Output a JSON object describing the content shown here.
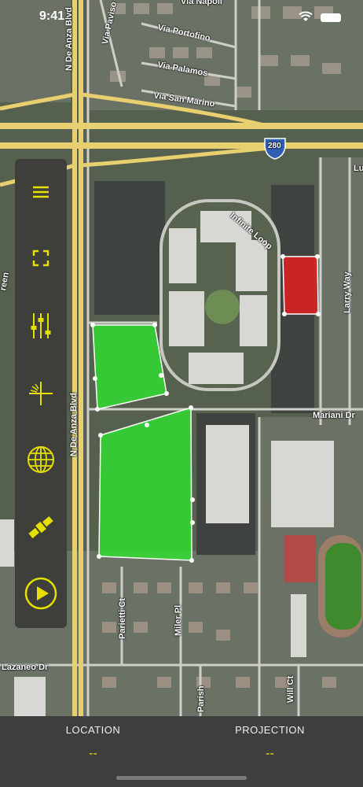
{
  "status_bar": {
    "time": "9:41"
  },
  "map": {
    "streets": {
      "via_napoli": "Via Napoli",
      "via_paviso": "Via Paviso",
      "via_portofino": "Via Portofino",
      "via_palamos": "Via Palamos",
      "via_san_marino": "Via San Marino",
      "n_de_anza_top": "N De Anza Blvd",
      "n_de_anza_mid": "N De Anza Blvd",
      "highway": "280",
      "infinite_loop": "Infinite Loop",
      "larry_way": "Larry Way",
      "mariani_dr": "Mariani Dr",
      "parish": "Parish",
      "parietti_ct": "Parietti Ct",
      "miller_pl": "Miler Pl",
      "lazaneo_dr": "Lazaneo Dr",
      "will_ct": "Will Ct",
      "green_partial": "reen",
      "lu_partial": "Lu"
    },
    "colors": {
      "green_zone": "#2ee62e",
      "red_zone": "#e02020",
      "road": "#e8cf70"
    }
  },
  "toolbar": {
    "tools": [
      {
        "name": "menu-icon"
      },
      {
        "name": "fullscreen-icon"
      },
      {
        "name": "sliders-icon"
      },
      {
        "name": "crosshair-icon"
      },
      {
        "name": "globe-icon"
      },
      {
        "name": "satellite-icon"
      },
      {
        "name": "play-icon"
      }
    ],
    "accent": "#e6e000"
  },
  "bottom_bar": {
    "location_label": "LOCATION",
    "location_value": "--",
    "projection_label": "PROJECTION",
    "projection_value": "--"
  }
}
